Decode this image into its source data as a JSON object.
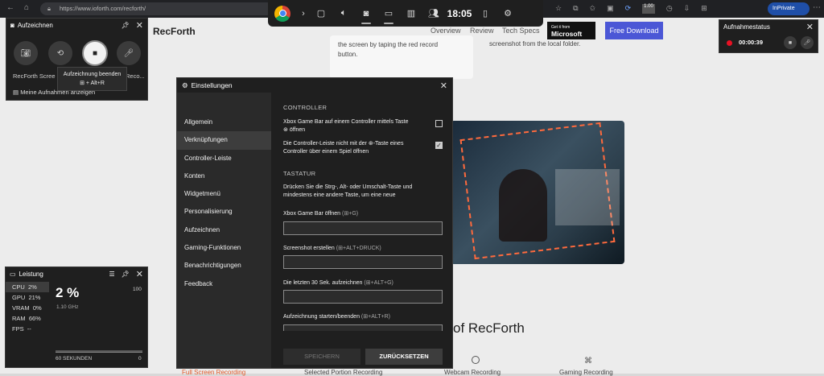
{
  "browser": {
    "url": "https://www.ioforth.com/recforth/",
    "inprivate": "InPrivate",
    "badge": "1.00"
  },
  "website": {
    "logo": "RecForth",
    "nav": [
      "Overview",
      "Review",
      "Tech Specs"
    ],
    "ms_badge_small": "Get it from",
    "ms_badge_big": "Microsoft",
    "download": "Free Download",
    "card_text_1": "the screen by taping the red record",
    "card_text_2": "button.",
    "card_text_3": "screenshot from the local folder.",
    "heading_fragment": "of RecForth",
    "bottom_tabs": [
      "Full Screen Recording",
      "Selected Portion Recording",
      "Webcam Recording",
      "Gaming Recording"
    ]
  },
  "gamebar": {
    "time": "18:05",
    "icons": [
      "chrome-icon",
      "chevron-right-icon",
      "widget-icon",
      "volume-icon",
      "capture-icon",
      "performance-icon",
      "chart-icon",
      "social-icon"
    ]
  },
  "capture_widget": {
    "title": "Aufzeichnen",
    "labels": [
      "RecForth Scree",
      "Reco..."
    ],
    "tooltip_title": "Aufzeichnung beenden",
    "tooltip_shortcut": "+ Alt+R",
    "footer": "Meine Aufnahmen anzeigen"
  },
  "status_widget": {
    "title": "Aufnahmestatus",
    "timer": "00:00:39"
  },
  "settings": {
    "title": "Einstellungen",
    "nav": [
      "Allgemein",
      "Verknüpfungen",
      "Controller-Leiste",
      "Konten",
      "Widgetmenü",
      "Personalisierung",
      "Aufzeichnen",
      "Gaming-Funktionen",
      "Benachrichtigungen",
      "Feedback"
    ],
    "selected_nav": "Verknüpfungen",
    "controller_header": "CONTROLLER",
    "opt1_a": "Xbox Game Bar auf einem Controller mittels Taste",
    "opt1_b": "öffnen",
    "opt1_checked": false,
    "opt2_a": "Die Controller-Leiste nicht mit der",
    "opt2_a2": "-Taste eines",
    "opt2_b": "Controller über einem Spiel öffnen",
    "opt2_checked": true,
    "keyboard_header": "TASTATUR",
    "keyboard_desc_1": "Drücken Sie die Strg-, Alt- oder Umschalt-Taste und",
    "keyboard_desc_2": "mindestens eine andere Taste, um eine neue",
    "shortcuts": [
      {
        "label": "Xbox Game Bar öffnen",
        "keys": "(⊞+G)"
      },
      {
        "label": "Screenshot erstellen",
        "keys": "(⊞+ALT+DRUCK)"
      },
      {
        "label": "Die letzten 30 Sek. aufzeichnen",
        "keys": "(⊞+ALT+G)"
      },
      {
        "label": "Aufzeichnung starten/beenden",
        "keys": "(⊞+ALT+R)"
      }
    ],
    "save": "SPEICHERN",
    "reset": "ZURÜCKSETZEN"
  },
  "performance": {
    "title": "Leistung",
    "rows": [
      {
        "name": "CPU",
        "value": "2%"
      },
      {
        "name": "GPU",
        "value": "21%"
      },
      {
        "name": "VRAM",
        "value": "0%"
      },
      {
        "name": "RAM",
        "value": "66%"
      },
      {
        "name": "FPS",
        "value": "--"
      }
    ],
    "big_value": "2 %",
    "freq": "1.10 GHz",
    "max": "100",
    "min": "0",
    "duration": "60 SEKUNDEN"
  }
}
